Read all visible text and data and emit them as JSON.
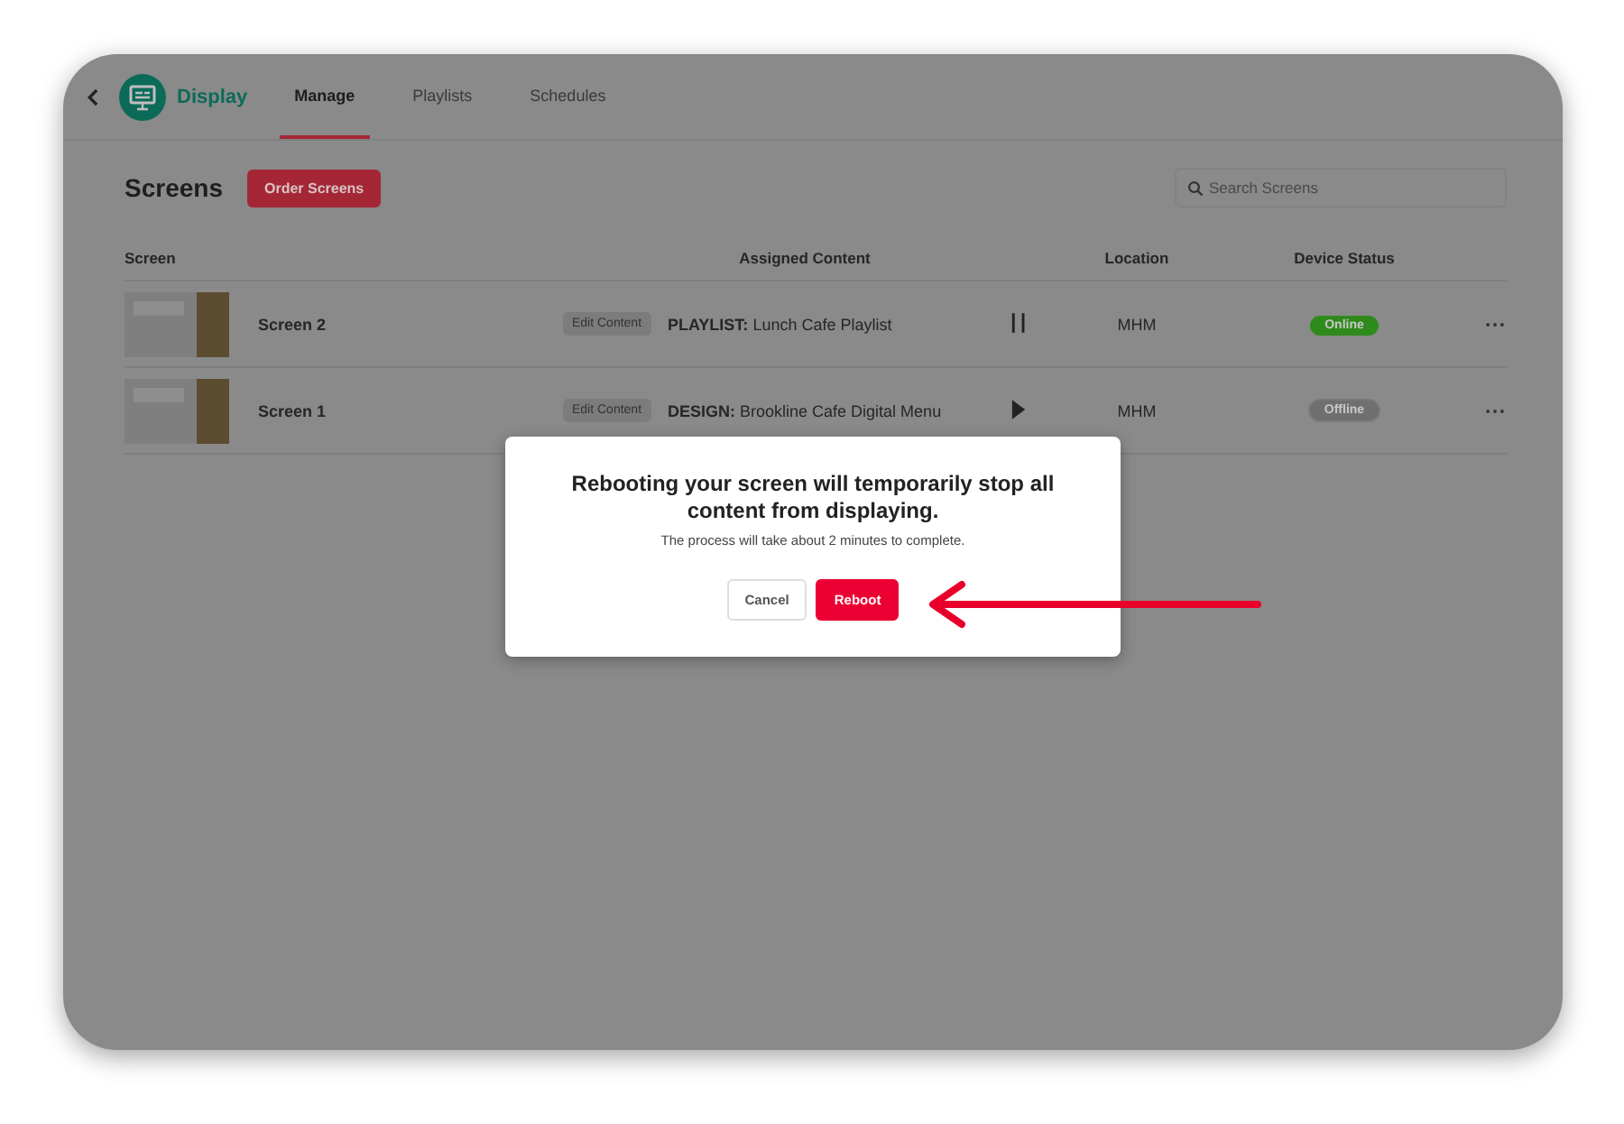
{
  "header": {
    "app_name": "Display",
    "tabs": [
      {
        "label": "Manage",
        "selected": true
      },
      {
        "label": "Playlists",
        "selected": false
      },
      {
        "label": "Schedules",
        "selected": false
      }
    ]
  },
  "page": {
    "title": "Screens",
    "order_button": "Order Screens",
    "search": {
      "placeholder": "Search Screens"
    }
  },
  "table": {
    "columns": [
      "Screen",
      "Assigned Content",
      "Location",
      "Device Status"
    ],
    "rows": [
      {
        "name": "Screen 2",
        "edit_button": "Edit Content",
        "content_type": "PLAYLIST:",
        "content_name": "Lunch Cafe Playlist",
        "playing": true,
        "location": "MHM",
        "status": "Online",
        "online": true
      },
      {
        "name": "Screen 1",
        "edit_button": "Edit Content",
        "content_type": "DESIGN:",
        "content_name": "Brookline Cafe Digital Menu",
        "playing": false,
        "location": "MHM",
        "status": "Offline",
        "online": false
      }
    ]
  },
  "dialog": {
    "title": "Rebooting your screen will temporarily stop all content from displaying.",
    "message": "The process will take about 2 minutes to complete.",
    "buttons": [
      {
        "label": "Cancel",
        "kind": "secondary"
      },
      {
        "label": "Reboot",
        "kind": "primary"
      }
    ]
  }
}
